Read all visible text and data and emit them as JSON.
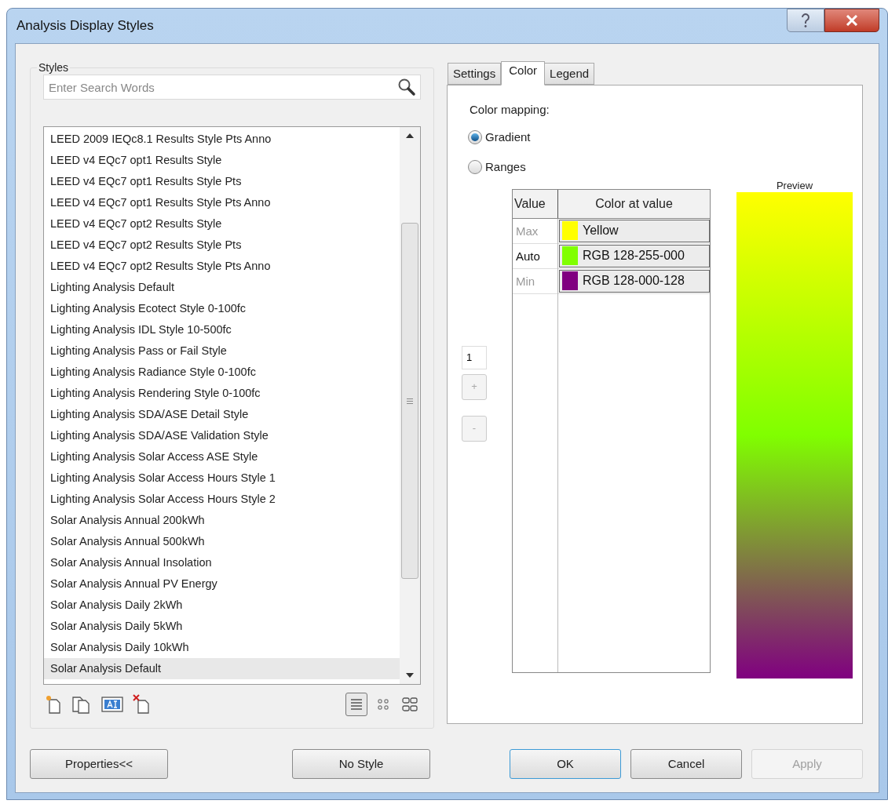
{
  "window": {
    "title": "Analysis Display Styles"
  },
  "styles": {
    "label": "Styles",
    "search": {
      "placeholder": "Enter Search Words"
    },
    "items": [
      {
        "label": "LEED 2009 IEQc8.1 Results Style Pts Anno",
        "selected": false
      },
      {
        "label": "LEED v4 EQc7 opt1 Results Style",
        "selected": false
      },
      {
        "label": "LEED v4 EQc7 opt1 Results Style Pts",
        "selected": false
      },
      {
        "label": "LEED v4 EQc7 opt1 Results Style Pts Anno",
        "selected": false
      },
      {
        "label": "LEED v4 EQc7 opt2 Results Style",
        "selected": false
      },
      {
        "label": "LEED v4 EQc7 opt2 Results Style Pts",
        "selected": false
      },
      {
        "label": "LEED v4 EQc7 opt2 Results Style Pts Anno",
        "selected": false
      },
      {
        "label": "Lighting Analysis Default",
        "selected": false
      },
      {
        "label": "Lighting Analysis Ecotect Style 0-100fc",
        "selected": false
      },
      {
        "label": "Lighting Analysis IDL Style 10-500fc",
        "selected": false
      },
      {
        "label": "Lighting Analysis Pass or Fail Style",
        "selected": false
      },
      {
        "label": "Lighting Analysis Radiance Style 0-100fc",
        "selected": false
      },
      {
        "label": "Lighting Analysis Rendering Style 0-100fc",
        "selected": false
      },
      {
        "label": "Lighting Analysis SDA/ASE Detail Style",
        "selected": false
      },
      {
        "label": "Lighting Analysis SDA/ASE Validation Style",
        "selected": false
      },
      {
        "label": "Lighting Analysis Solar Access ASE Style",
        "selected": false
      },
      {
        "label": "Lighting Analysis Solar Access Hours Style 1",
        "selected": false
      },
      {
        "label": "Lighting Analysis Solar Access Hours Style 2",
        "selected": false
      },
      {
        "label": "Solar Analysis Annual 200kWh",
        "selected": false
      },
      {
        "label": "Solar Analysis Annual 500kWh",
        "selected": false
      },
      {
        "label": "Solar Analysis Annual Insolation",
        "selected": false
      },
      {
        "label": "Solar Analysis Annual PV Energy",
        "selected": false
      },
      {
        "label": "Solar Analysis Daily 2kWh",
        "selected": false
      },
      {
        "label": "Solar Analysis Daily 5kWh",
        "selected": false
      },
      {
        "label": "Solar Analysis Daily 10kWh",
        "selected": false
      },
      {
        "label": "Solar Analysis Default",
        "selected": true
      }
    ],
    "view_modes": [
      {
        "kind": "list",
        "selected": true
      },
      {
        "kind": "small",
        "selected": false
      },
      {
        "kind": "large",
        "selected": false
      }
    ]
  },
  "tabs": [
    {
      "label": "Settings",
      "selected": false
    },
    {
      "label": "Color",
      "selected": true
    },
    {
      "label": "Legend",
      "selected": false
    }
  ],
  "color": {
    "label": "Color mapping:",
    "options": [
      {
        "label": "Gradient",
        "selected": true
      },
      {
        "label": "Ranges",
        "selected": false
      }
    ],
    "table": {
      "columns": [
        "Value",
        "Color at value"
      ],
      "rows": [
        {
          "value": "Max",
          "disabled": true,
          "color": "#ffff00",
          "name": "Yellow"
        },
        {
          "value": "Auto",
          "disabled": false,
          "color": "#80ff00",
          "name": "RGB 128-255-000"
        },
        {
          "value": "Min",
          "disabled": true,
          "color": "#800080",
          "name": "RGB 128-000-128"
        }
      ]
    },
    "spinner": {
      "value": "1",
      "plus": "+",
      "minus": "-"
    },
    "preview": {
      "label": "Preview"
    }
  },
  "buttons": [
    {
      "label": "Properties<<",
      "kind": "left",
      "disabled": false,
      "default": false
    },
    {
      "label": "No Style",
      "kind": "left",
      "disabled": false,
      "default": false
    },
    {
      "label": "OK",
      "kind": "right",
      "disabled": false,
      "default": true
    },
    {
      "label": "Cancel",
      "kind": "right",
      "disabled": false,
      "default": false
    },
    {
      "label": "Apply",
      "kind": "right",
      "disabled": true,
      "default": false
    }
  ]
}
